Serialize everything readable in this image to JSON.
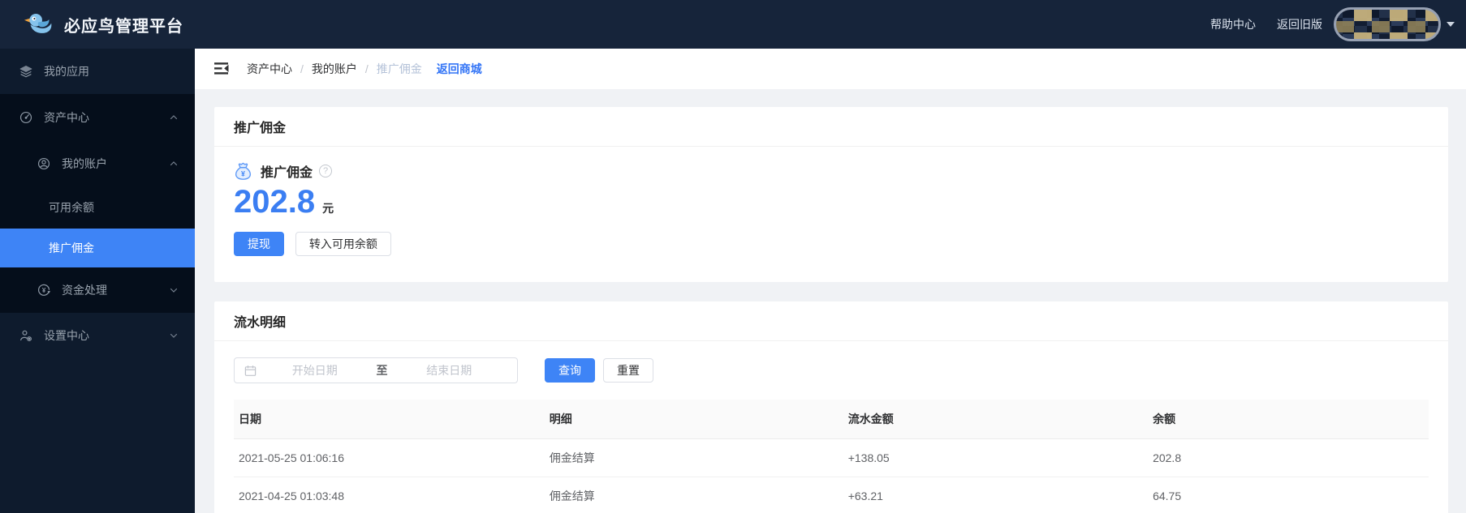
{
  "topbar": {
    "brand": "必应鸟管理平台",
    "help_link": "帮助中心",
    "back_old_link": "返回旧版"
  },
  "sidebar": {
    "items": [
      {
        "label": "我的应用",
        "icon": "layers-icon",
        "level": 1
      },
      {
        "label": "资产中心",
        "icon": "dashboard-icon",
        "level": 1,
        "expanded": true
      },
      {
        "label": "我的账户",
        "icon": "user-circle-icon",
        "level": 2,
        "expanded": true
      },
      {
        "label": "可用余额",
        "level": 3
      },
      {
        "label": "推广佣金",
        "level": 3,
        "selected": true
      },
      {
        "label": "资金处理",
        "icon": "yen-circle-icon",
        "level": 2,
        "expanded": false
      },
      {
        "label": "设置中心",
        "icon": "user-gear-icon",
        "level": 1,
        "expanded": false
      }
    ]
  },
  "breadcrumb": {
    "items": [
      "资产中心",
      "我的账户",
      "推广佣金"
    ],
    "separator": "/",
    "back_link": "返回商城"
  },
  "commission": {
    "card_title": "推广佣金",
    "panel_title": "推广佣金",
    "help_icon": "?",
    "amount": "202.8",
    "unit": "元",
    "withdraw_btn": "提现",
    "transfer_btn": "转入可用余额"
  },
  "flow": {
    "card_title": "流水明细",
    "date_start_placeholder": "开始日期",
    "date_to_label": "至",
    "date_end_placeholder": "结束日期",
    "search_btn": "查询",
    "reset_btn": "重置",
    "table": {
      "headers": [
        "日期",
        "明细",
        "流水金额",
        "余额"
      ],
      "rows": [
        [
          "2021-05-25 01:06:16",
          "佣金结算",
          "+138.05",
          "202.8"
        ],
        [
          "2021-04-25 01:03:48",
          "佣金结算",
          "+63.21",
          "64.75"
        ]
      ]
    }
  },
  "colors": {
    "topbar_bg": "#16243a",
    "sidebar_bg": "#0e1b2d",
    "sidebar_submenu_bg": "#050e1b",
    "accent_blue": "#3e84f6",
    "amount_blue": "#3b7ef2",
    "link_blue": "#3274f6",
    "page_bg": "#f0f2f5",
    "breadcrumb_current": "#b4c2d8"
  }
}
